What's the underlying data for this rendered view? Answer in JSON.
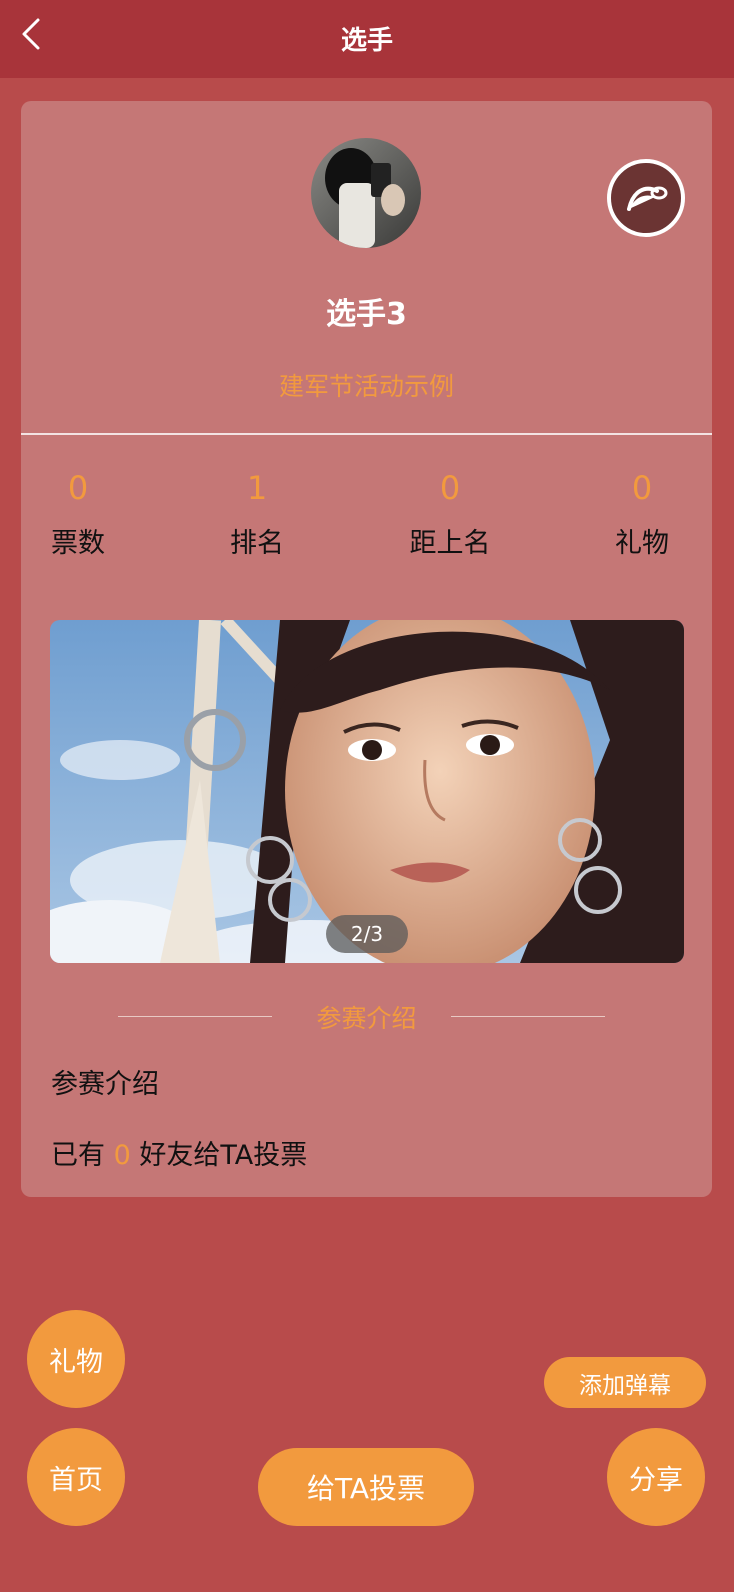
{
  "header": {
    "title": "选手",
    "back_icon": "chevron-left-icon"
  },
  "player": {
    "name": "选手3",
    "activity": "建军节活动示例",
    "avatar_icon": "avatar-photo",
    "music_icon": "music-note-icon"
  },
  "stats": [
    {
      "value": "0",
      "label": "票数"
    },
    {
      "value": "1",
      "label": "排名"
    },
    {
      "value": "0",
      "label": "距上名"
    },
    {
      "value": "0",
      "label": "礼物"
    }
  ],
  "gallery": {
    "counter": "2/3"
  },
  "intro": {
    "section_title": "参赛介绍",
    "text": "参赛介绍",
    "voters_prefix": "已有",
    "voters_count": "0",
    "voters_suffix": "好友给TA投票"
  },
  "actions": {
    "gift": "礼物",
    "home": "首页",
    "vote": "给TA投票",
    "danmaku": "添加弹幕",
    "share": "分享"
  },
  "colors": {
    "background": "#b84b4b",
    "header": "#a8343a",
    "card": "#c57776",
    "accent": "#f29a3e"
  }
}
